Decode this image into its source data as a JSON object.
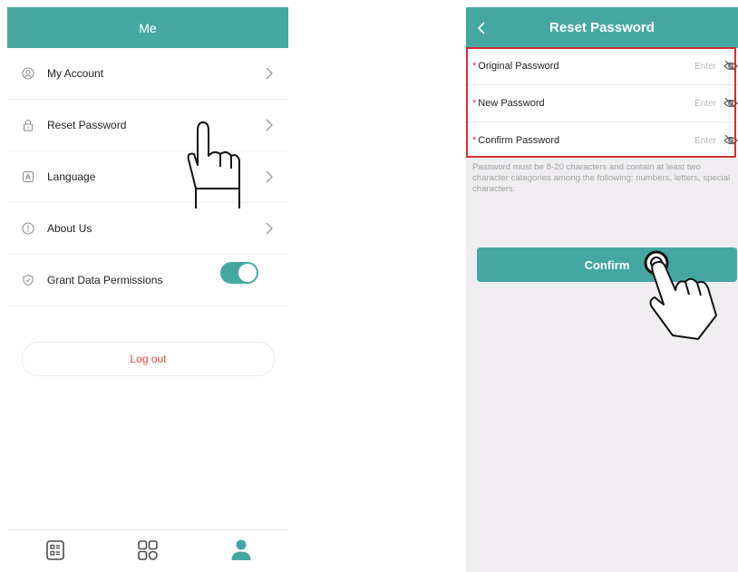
{
  "left_screen": {
    "title": "Me",
    "menu": [
      {
        "label": "My Account",
        "icon": "user-circle-icon"
      },
      {
        "label": "Reset Password",
        "icon": "lock-icon"
      },
      {
        "label": "Language",
        "icon": "language-icon"
      },
      {
        "label": "About Us",
        "icon": "info-icon"
      },
      {
        "label": "Grant Data Permissions",
        "icon": "shield-check-icon",
        "toggle_on": true
      }
    ],
    "logout_label": "Log out",
    "tabbar": [
      "dashboard-icon",
      "apps-grid-icon",
      "profile-icon"
    ]
  },
  "right_screen": {
    "title": "Reset Password",
    "fields": [
      {
        "required_mark": "*",
        "label": "Original Password",
        "placeholder": "Enter"
      },
      {
        "required_mark": "*",
        "label": "New Password",
        "placeholder": "Enter"
      },
      {
        "required_mark": "*",
        "label": "Confirm Password",
        "placeholder": "Enter"
      }
    ],
    "hint": "Password must be 8-20 characters and contain at least two character categories among the following: numbers, letters, special characters.",
    "confirm_label": "Confirm"
  },
  "colors": {
    "accent": "#45a8a0",
    "logout_text": "#e84a3d",
    "required": "#e53935",
    "highlight": "#d32f2f",
    "right_bg": "#efedf0"
  }
}
